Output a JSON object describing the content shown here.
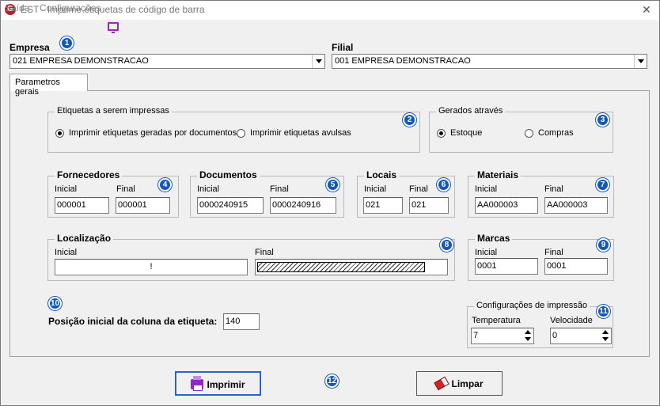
{
  "window": {
    "title": "EST - Imprime etiquetas de código de barra",
    "logo_text": "G",
    "close_glyph": "✕"
  },
  "menu": {
    "items": [
      "Saída",
      "Configurações"
    ],
    "icon": "monitor-icon"
  },
  "empresa": {
    "label": "Empresa",
    "value": "021 EMPRESA DEMONSTRACAO"
  },
  "filial": {
    "label": "Filial",
    "value": "001 EMPRESA DEMONSTRACAO"
  },
  "tabs": [
    {
      "label": "Parametros gerais",
      "active": true
    }
  ],
  "etiquetas": {
    "title": "Etiquetas a serem impressas",
    "options": [
      {
        "label": "Imprimir etiquetas geradas por documentos",
        "checked": true
      },
      {
        "label": "Imprimir etiquetas avulsas",
        "checked": false
      }
    ]
  },
  "gerados": {
    "title": "Gerados através",
    "options": [
      {
        "label": "Estoque",
        "checked": true
      },
      {
        "label": "Compras",
        "checked": false
      }
    ]
  },
  "fornecedores": {
    "title": "Fornecedores",
    "inicial_label": "Inicial",
    "final_label": "Final",
    "inicial": "000001",
    "final": "000001"
  },
  "documentos": {
    "title": "Documentos",
    "inicial_label": "Inicial",
    "final_label": "Final",
    "inicial": "0000240915",
    "final": "0000240916"
  },
  "locais": {
    "title": "Locais",
    "inicial_label": "Inicial",
    "final_label": "Final",
    "inicial": "021",
    "final": "021"
  },
  "materiais": {
    "title": "Materiais",
    "inicial_label": "Inicial",
    "final_label": "Final",
    "inicial": "AA000003",
    "final": "AA000003"
  },
  "localizacao": {
    "title": "Localização",
    "inicial_label": "Inicial",
    "final_label": "Final",
    "inicial": "!",
    "final": ""
  },
  "marcas": {
    "title": "Marcas",
    "inicial_label": "Inicial",
    "final_label": "Final",
    "inicial": "0001",
    "final": "0001"
  },
  "posicao": {
    "label": "Posição inicial da coluna da etiqueta:",
    "value": "140"
  },
  "impressao": {
    "title": "Configurações de impressão",
    "temperatura_label": "Temperatura",
    "temperatura": "7",
    "velocidade_label": "Velocidade",
    "velocidade": "0"
  },
  "buttons": {
    "imprimir": "Imprimir",
    "limpar": "Limpar"
  },
  "badges": [
    "1",
    "2",
    "3",
    "4",
    "5",
    "6",
    "7",
    "8",
    "9",
    "10",
    "11",
    "12"
  ],
  "colors": {
    "badge": "#1357b8",
    "logo": "#c0192a",
    "monitor_icon": "#a020c0",
    "print_icon": "#8a2bc6",
    "eraser_icon": "#d8202a"
  }
}
